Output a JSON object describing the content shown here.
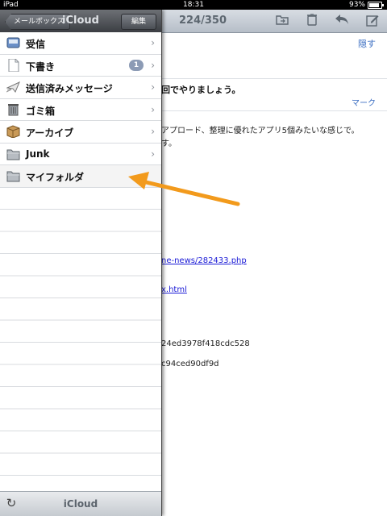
{
  "status_bar": {
    "carrier": "iPad",
    "time": "18:31",
    "battery": "93%"
  },
  "mail_toolbar": {
    "counter": "224/350",
    "icons": [
      "folder-move-icon",
      "trash-icon",
      "reply-icon",
      "compose-icon"
    ]
  },
  "mail_body": {
    "hide_label": "隠す",
    "subject": "回でやりましょう。",
    "mark_label": "マーク",
    "lines": [
      "アプロード、整理に優れたアプリ5個みたいな感じで。",
      "す。"
    ],
    "links": [
      "ne-news/282433.php",
      "x.html"
    ],
    "hashes": [
      "24ed3978f418cdc528",
      "c94ced90df9d"
    ]
  },
  "popover": {
    "back_label": "メールボックス",
    "title": "iCloud",
    "edit_label": "編集",
    "folders": [
      {
        "label": "受信",
        "icon": "inbox-icon"
      },
      {
        "label": "下書き",
        "icon": "drafts-icon",
        "badge": "1"
      },
      {
        "label": "送信済みメッセージ",
        "icon": "sent-icon"
      },
      {
        "label": "ゴミ箱",
        "icon": "trash-icon"
      },
      {
        "label": "アーカイブ",
        "icon": "archive-box-icon"
      },
      {
        "label": "Junk",
        "icon": "folder-icon"
      },
      {
        "label": "マイフォルダ",
        "icon": "folder-icon"
      }
    ],
    "footer_title": "iCloud"
  },
  "colors": {
    "accent_arrow": "#f29a1c",
    "link": "#3b6ec2",
    "badge": "#8c9bb5"
  }
}
